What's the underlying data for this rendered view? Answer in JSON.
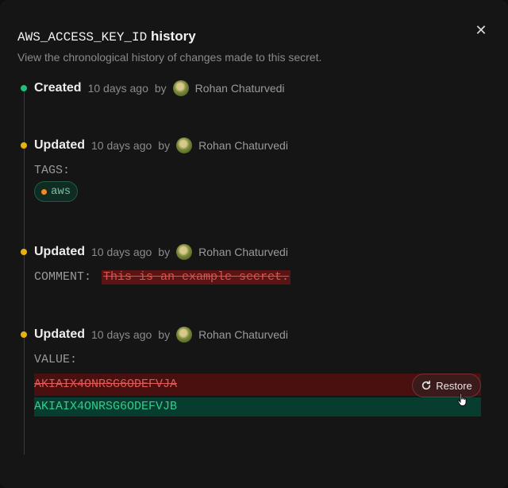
{
  "dialog": {
    "secret_name": "AWS_ACCESS_KEY_ID",
    "title_suffix": "history",
    "subtitle": "View the chronological history of changes made to this secret.",
    "close_icon": "close-icon"
  },
  "events": [
    {
      "action": "Created",
      "when": "10 days ago",
      "by": "by",
      "user": "Rohan Chaturvedi",
      "status_color": "#1fbf7a"
    },
    {
      "action": "Updated",
      "when": "10 days ago",
      "by": "by",
      "user": "Rohan Chaturvedi",
      "status_color": "#e6b011",
      "field": "TAGS:",
      "tag": "aws"
    },
    {
      "action": "Updated",
      "when": "10 days ago",
      "by": "by",
      "user": "Rohan Chaturvedi",
      "status_color": "#e6b011",
      "field": "COMMENT:",
      "removed": "This is an example secret."
    },
    {
      "action": "Updated",
      "when": "10 days ago",
      "by": "by",
      "user": "Rohan Chaturvedi",
      "status_color": "#e6b011",
      "field": "VALUE:",
      "removed": "AKIAIX4ONRSG6ODEFVJA",
      "added": "AKIAIX4ONRSG6ODEFVJB",
      "restore_label": "Restore"
    }
  ]
}
